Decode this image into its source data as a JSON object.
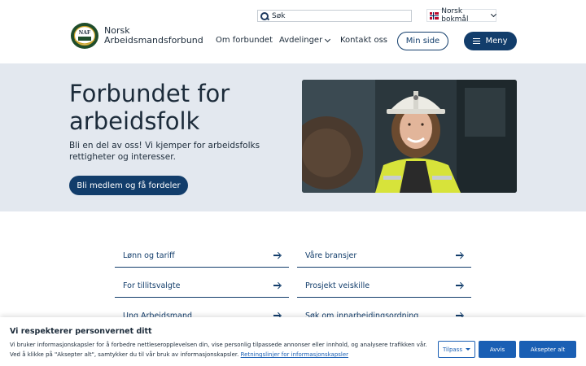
{
  "header": {
    "search_placeholder": "Søk",
    "language": "Norsk bokmål",
    "brand_line1": "Norsk",
    "brand_line2": "Arbeidsmandsforbund",
    "logo_text": "NAF",
    "nav": {
      "om": "Om forbundet",
      "avdelinger": "Avdelinger",
      "kontakt": "Kontakt oss"
    },
    "min_side": "Min side",
    "meny": "Meny"
  },
  "hero": {
    "title": "Forbundet for arbeidsfolk",
    "text": "Bli en del av oss! Vi kjemper for arbeidsfolks rettigheter og interesser.",
    "cta": "Bli medlem og få fordeler"
  },
  "links": {
    "left": [
      "Lønn og tariff",
      "For tillitsvalgte",
      "Ung Arbeidsmand"
    ],
    "right": [
      "Våre bransjer",
      "Prosjekt veiskille",
      "Søk om innarbeidingsordning"
    ]
  },
  "cookie": {
    "title": "Vi respekterer personvernet ditt",
    "text": "Vi bruker informasjonskapsler for å forbedre nettleseropplevelsen din, vise personlig tilpassede annonser eller innhold, og analysere trafikken vår. Ved å klikke på \"Aksepter alt\", samtykker du til vår bruk av informasjonskapsler.",
    "link": "Retningslinjer for informasjonskapsler",
    "tilpass": "Tilpass",
    "avvis": "Avvis",
    "aksepter": "Aksepter alt"
  },
  "colors": {
    "primary": "#123d6b",
    "hero_bg": "#e3e8ef",
    "cookie_accent": "#1a5fb4"
  }
}
